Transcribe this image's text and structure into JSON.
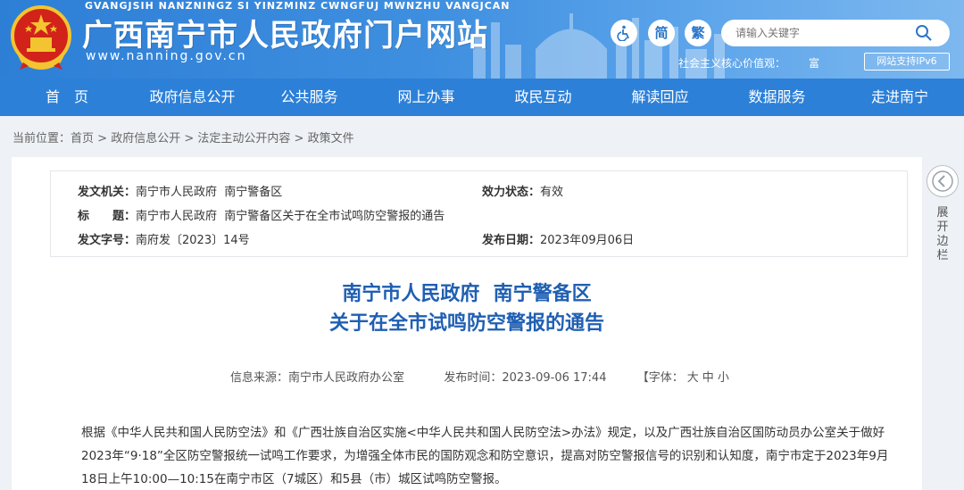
{
  "header": {
    "pinyin": "GVANGJSIH NANZNINGZ SI YINZMINZ CWNGFUJ MWNZHU VANGJCAN",
    "title": "广西南宁市人民政府门户网站",
    "url": "www.nanning.gov.cn",
    "accessibility_icon": "wheelchair-icon",
    "simplified_label": "简",
    "traditional_label": "繁",
    "search_placeholder": "请输入关键字",
    "core_values_label": "社会主义核心价值观：",
    "core_values_word": "富",
    "ipv6_label": "网站支持IPv6"
  },
  "nav": {
    "items": [
      {
        "label": "首　页"
      },
      {
        "label": "政府信息公开"
      },
      {
        "label": "公共服务"
      },
      {
        "label": "网上办事"
      },
      {
        "label": "政民互动"
      },
      {
        "label": "解读回应"
      },
      {
        "label": "数据服务"
      },
      {
        "label": "走进南宁"
      }
    ]
  },
  "breadcrumb": {
    "prefix": "当前位置：",
    "items": [
      "首页",
      "政府信息公开",
      "法定主动公开内容",
      "政策文件"
    ],
    "separator": " > "
  },
  "info": {
    "issuer_label": "发文机关：",
    "issuer_value": "南宁市人民政府  南宁警备区",
    "status_label": "效力状态：",
    "status_value": "有效",
    "title_label": "标　　题：",
    "title_value": "南宁市人民政府  南宁警备区关于在全市试鸣防空警报的通告",
    "docno_label": "发文字号：",
    "docno_value": "南府发〔2023〕14号",
    "date_label": "发布日期：",
    "date_value": "2023年09月06日"
  },
  "document": {
    "title_line1": "南宁市人民政府  南宁警备区",
    "title_line2": "关于在全市试鸣防空警报的通告",
    "source_label": "信息来源：",
    "source_value": "南宁市人民政府办公室",
    "time_label": "发布时间：",
    "time_value": "2023-09-06 17:44",
    "font_label": "【字体：",
    "font_large": "大",
    "font_medium": "中",
    "font_small": "小",
    "body": "根据《中华人民共和国人民防空法》和《广西壮族自治区实施<中华人民共和国人民防空法>办法》规定，以及广西壮族自治区国防动员办公室关于做好2023年“9·18”全区防空警报统一试鸣工作要求，为增强全体市民的国防观念和防空意识，提高对防空警报信号的识别和认知度，南宁市定于2023年9月18日上午10:00—10:15在南宁市区（7城区）和5县（市）城区试鸣防空警报。"
  },
  "side": {
    "toggle_icon": "chevron-left-icon",
    "label": "展开边栏"
  },
  "colors": {
    "header_blue": "#2d7fd6",
    "nav_blue": "#2c80d8",
    "title_blue": "#1f5fb3",
    "emblem_red": "#d2231b",
    "emblem_gold": "#f4c430"
  }
}
